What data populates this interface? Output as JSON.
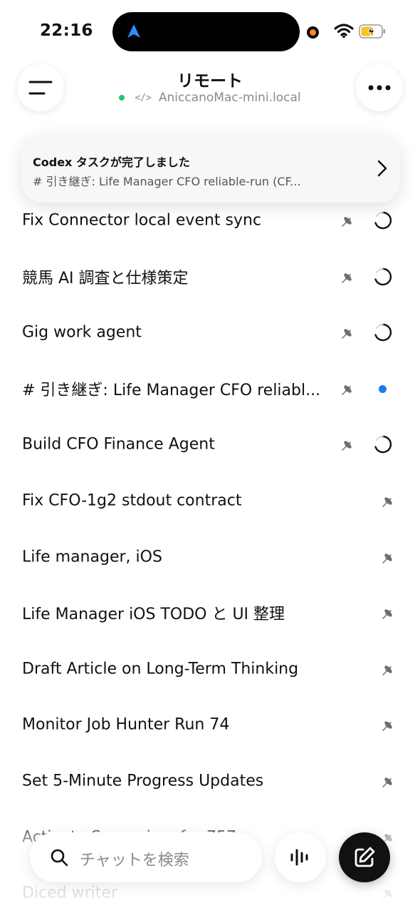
{
  "status_bar": {
    "time": "22:16",
    "icons": [
      "navigation-arrow-icon",
      "recording-dot-icon",
      "wifi-icon",
      "battery-charging-icon"
    ]
  },
  "header": {
    "title": "リモート",
    "host": "AniccanoMac-mini.local",
    "status_color": "#2fbf71",
    "code_icon": "</>"
  },
  "banner": {
    "title": "Codex タスクが完了しました",
    "body": "# 引き継ぎ: Life Manager CFO reliable-run (CF..."
  },
  "threads": [
    {
      "title": "Fix Connector local event sync",
      "pinned": true,
      "status": "running"
    },
    {
      "title": "競馬 AI 調査と仕様策定",
      "pinned": true,
      "status": "running"
    },
    {
      "title": "Gig work agent",
      "pinned": true,
      "status": "running"
    },
    {
      "title": "# 引き継ぎ: Life Manager CFO reliabl...",
      "pinned": true,
      "status": "unread"
    },
    {
      "title": "Build CFO Finance Agent",
      "pinned": true,
      "status": "running"
    },
    {
      "title": "Fix CFO-1g2 stdout contract",
      "pinned": true,
      "status": "idle"
    },
    {
      "title": "Life manager, iOS",
      "pinned": true,
      "status": "idle"
    },
    {
      "title": "Life Manager iOS TODO と UI 整理",
      "pinned": true,
      "status": "idle"
    },
    {
      "title": "Draft Article on Long-Term Thinking",
      "pinned": true,
      "status": "idle"
    },
    {
      "title": "Monitor Job Hunter Run 74",
      "pinned": true,
      "status": "idle"
    },
    {
      "title": "Set 5-Minute Progress Updates",
      "pinned": true,
      "status": "idle"
    },
    {
      "title": "Activate Supervisor for 757",
      "pinned": true,
      "status": "idle"
    },
    {
      "title": "Diced writer",
      "pinned": true,
      "status": "idle"
    }
  ],
  "search": {
    "placeholder": "チャットを検索"
  },
  "colors": {
    "accent_blue": "#1a7cf5",
    "online_green": "#2fbf71",
    "recording_orange": "#ff8a1c"
  }
}
